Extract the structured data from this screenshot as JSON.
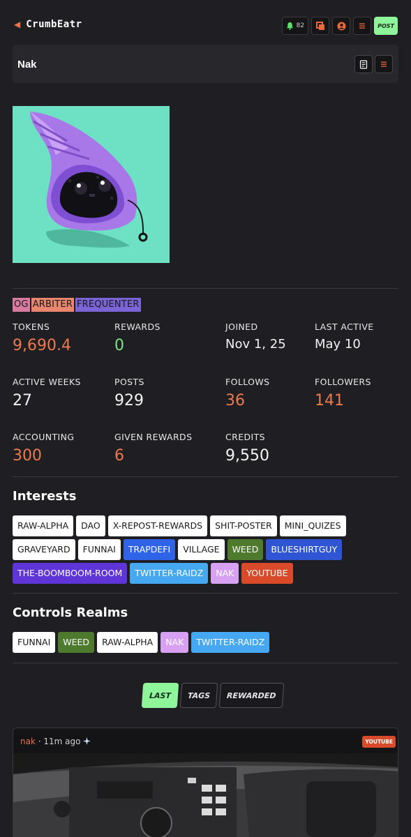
{
  "header": {
    "brand": "CrumbEatr",
    "notification_count": "82",
    "post_label": "POST"
  },
  "profile": {
    "name": "Nak",
    "badges": [
      {
        "label": "OG",
        "color": "#d97aa0"
      },
      {
        "label": "ARBITER",
        "color": "#e8866e"
      },
      {
        "label": "FREQUENTER",
        "color": "#7a64d6"
      }
    ]
  },
  "stats": {
    "tokens": {
      "label": "TOKENS",
      "value": "9,690.4"
    },
    "rewards": {
      "label": "REWARDS",
      "value": "0"
    },
    "joined": {
      "label": "JOINED",
      "value": "Nov 1, 25"
    },
    "last_active": {
      "label": "LAST ACTIVE",
      "value": "May 10"
    },
    "active_weeks": {
      "label": "ACTIVE WEEKS",
      "value": "27"
    },
    "posts": {
      "label": "POSTS",
      "value": "929"
    },
    "follows": {
      "label": "FOLLOWS",
      "value": "36"
    },
    "followers": {
      "label": "FOLLOWERS",
      "value": "141"
    },
    "accounting": {
      "label": "ACCOUNTING",
      "value": "300"
    },
    "given_rewards": {
      "label": "GIVEN REWARDS",
      "value": "6"
    },
    "credits": {
      "label": "CREDITS",
      "value": "9,550"
    }
  },
  "interests": {
    "title": "Interests",
    "tags": [
      {
        "label": "RAW-ALPHA",
        "color": "#ffffff"
      },
      {
        "label": "DAO",
        "color": "#ffffff"
      },
      {
        "label": "X-REPOST-REWARDS",
        "color": "#ffffff"
      },
      {
        "label": "SHIT-POSTER",
        "color": "#ffffff"
      },
      {
        "label": "MINI_QUIZES",
        "color": "#ffffff"
      },
      {
        "label": "GRAVEYARD",
        "color": "#ffffff"
      },
      {
        "label": "FUNNAI",
        "color": "#ffffff"
      },
      {
        "label": "TRAPDEFI",
        "color": "#2f64e8"
      },
      {
        "label": "VILLAGE",
        "color": "#ffffff"
      },
      {
        "label": "WEED",
        "color": "#4e7a2e"
      },
      {
        "label": "BLUESHIRTGUY",
        "color": "#2f55d4"
      },
      {
        "label": "THE-BOOMBOOM-ROOM",
        "color": "#5f35d8"
      },
      {
        "label": "TWITTER-RAIDZ",
        "color": "#45a8f0"
      },
      {
        "label": "NAK",
        "color": "#d8a0f0"
      },
      {
        "label": "YOUTUBE",
        "color": "#d94a2b"
      }
    ]
  },
  "realms": {
    "title": "Controls Realms",
    "tags": [
      {
        "label": "FUNNAI",
        "color": "#ffffff"
      },
      {
        "label": "WEED",
        "color": "#4e7a2e"
      },
      {
        "label": "RAW-ALPHA",
        "color": "#ffffff"
      },
      {
        "label": "NAK",
        "color": "#d8a0f0"
      },
      {
        "label": "TWITTER-RAIDZ",
        "color": "#45a8f0"
      }
    ]
  },
  "tabs": [
    {
      "label": "LAST",
      "active": true
    },
    {
      "label": "TAGS",
      "active": false
    },
    {
      "label": "REWARDED",
      "active": false
    }
  ],
  "post": {
    "author": "nak",
    "time": "11m ago",
    "tag": "YOUTUBE"
  },
  "icons": {
    "back": "arrow-left-icon",
    "bell": "bell-icon",
    "inbox": "stack-icon",
    "user": "user-circle-icon",
    "menu": "menu-icon",
    "notes": "notes-icon",
    "sparkle": "sparkle-icon"
  },
  "colors": {
    "accent_orange": "#ec7a4e",
    "accent_green": "#8ff59a",
    "background": "#1f1e22"
  }
}
